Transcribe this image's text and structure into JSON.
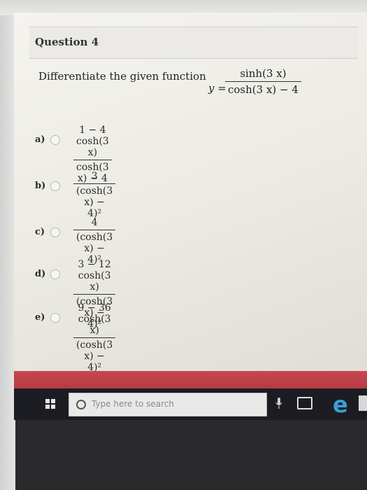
{
  "question": {
    "title": "Question 4",
    "prompt": "Differentiate the given function",
    "function_var": "y =",
    "function_num": "sinh(3 x)",
    "function_den": "cosh(3 x) − 4"
  },
  "options": [
    {
      "label": "a)",
      "num": "1 − 4 cosh(3 x)",
      "den": "cosh(3 x) − 4"
    },
    {
      "label": "b)",
      "num": "3",
      "den": "(cosh(3 x) − 4)²"
    },
    {
      "label": "c)",
      "num": "4",
      "den": "(cosh(3 x) − 4)²"
    },
    {
      "label": "d)",
      "num": "3 − 12 cosh(3 x)",
      "den": "(cosh(3 x) − 4)²"
    },
    {
      "label": "e)",
      "num": "9 − 36 cosh(3 x)",
      "den": "(cosh(3 x) − 4)²"
    }
  ],
  "taskbar": {
    "search_placeholder": "Type here to search"
  },
  "colors": {
    "accent_bar": "#b63942",
    "edge_icon": "#3a9fd8",
    "taskbar": "#1c1d22"
  }
}
